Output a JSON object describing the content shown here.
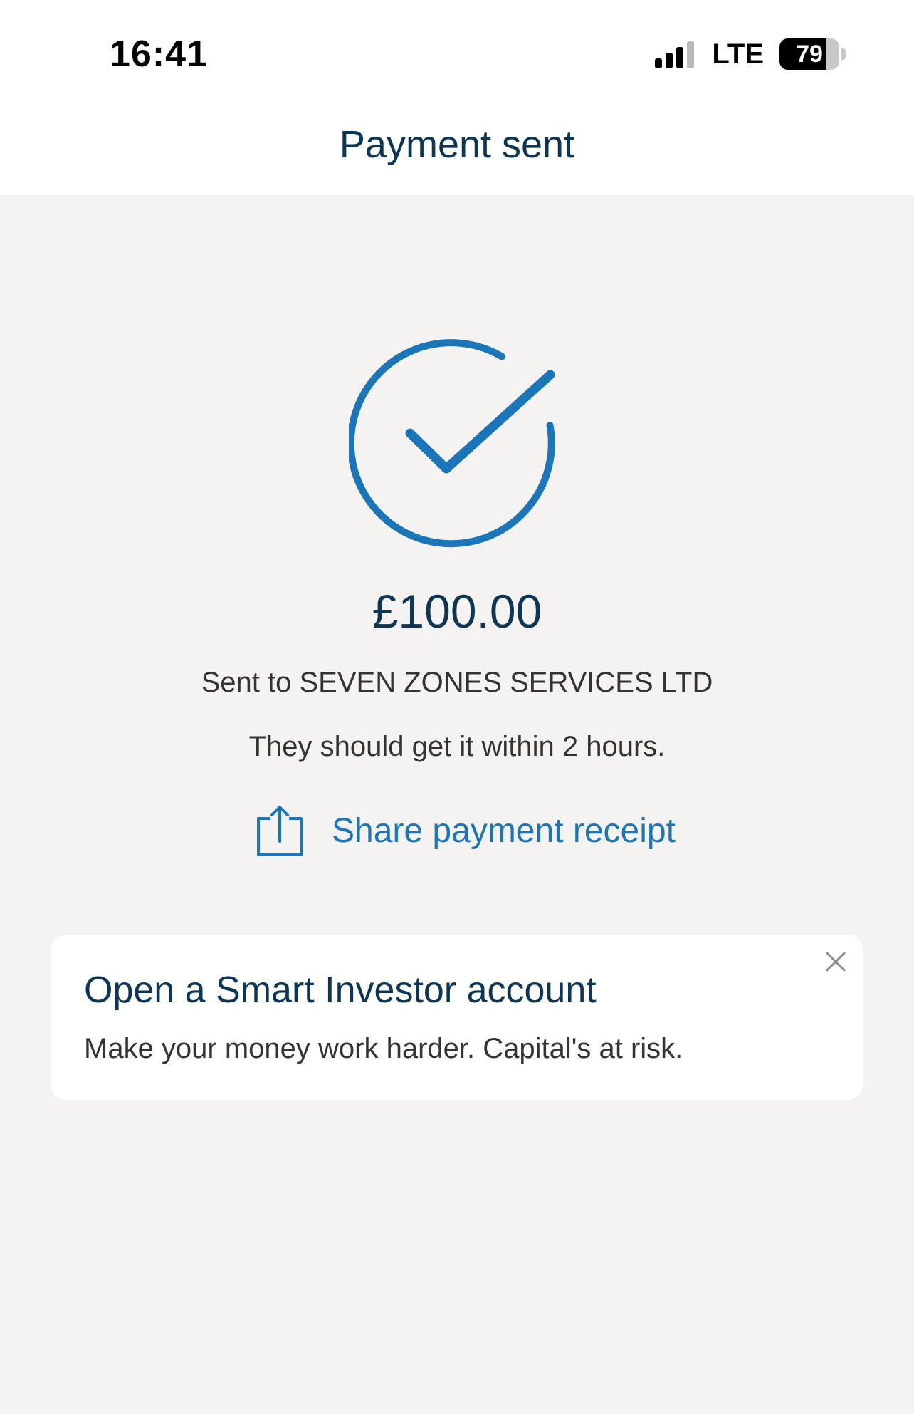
{
  "status_bar": {
    "time": "16:41",
    "network": "LTE",
    "battery": "79",
    "battery_level": 0.79,
    "signal_bars": 3
  },
  "header": {
    "title": "Payment sent"
  },
  "icons": {
    "success": "check-circle-icon",
    "share": "share-icon",
    "close": "close-icon"
  },
  "payment": {
    "amount": "£100.00",
    "recipient_line": "Sent to SEVEN ZONES SERVICES LTD",
    "eta_line": "They should get it within 2 hours.",
    "share_label": "Share payment receipt"
  },
  "promo": {
    "title": "Open a Smart Investor account",
    "text": "Make your money work harder. Capital's at risk."
  },
  "colors": {
    "accent": "#1a76b9",
    "title_text": "#0c3556",
    "background": "#f4f3f2"
  }
}
